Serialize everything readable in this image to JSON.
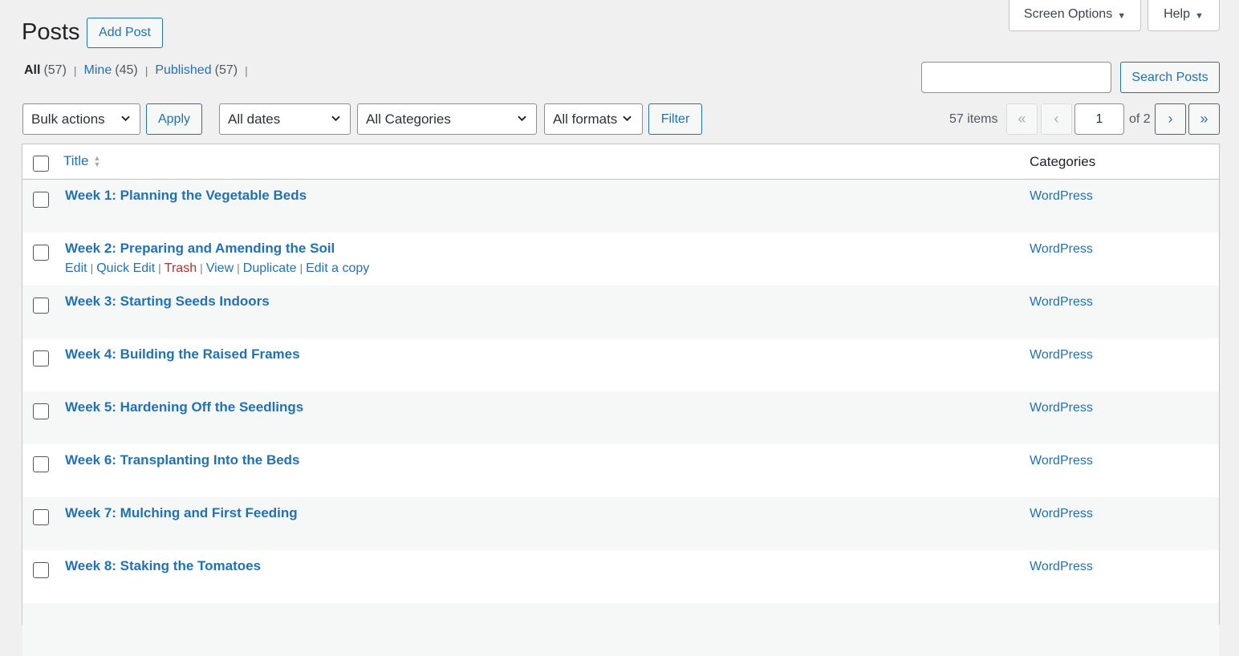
{
  "header": {
    "title": "Posts",
    "add_post": "Add Post",
    "screen_options": "Screen Options",
    "help": "Help"
  },
  "views": [
    {
      "label": "All",
      "count": "(57)"
    },
    {
      "label": "Mine",
      "count": "(45)"
    },
    {
      "label": "Published",
      "count": "(57)"
    }
  ],
  "search": {
    "button": "Search Posts",
    "value": ""
  },
  "filters": {
    "bulk_actions": "Bulk actions",
    "apply": "Apply",
    "dates": "All dates",
    "categories": "All Categories",
    "formats": "All formats",
    "filter": "Filter"
  },
  "pagination": {
    "items": "57 items",
    "first": "«",
    "prev": "‹",
    "current_page": "1",
    "of_total": "of 2",
    "next": "›",
    "last": "»"
  },
  "table": {
    "col_title": "Title",
    "col_categories": "Categories",
    "row_actions": {
      "edit": "Edit",
      "quick_edit": "Quick Edit",
      "trash": "Trash",
      "view": "View",
      "duplicate": "Duplicate",
      "edit_copy": "Edit a copy"
    },
    "rows": [
      {
        "title": "Week 1: Planning the Vegetable Beds",
        "category": "WordPress"
      },
      {
        "title": "Week 2: Preparing and Amending the Soil",
        "category": "WordPress"
      },
      {
        "title": "Week 3: Starting Seeds Indoors",
        "category": "WordPress"
      },
      {
        "title": "Week 4: Building the Raised Frames",
        "category": "WordPress"
      },
      {
        "title": "Week 5: Hardening Off the Seedlings",
        "category": "WordPress"
      },
      {
        "title": "Week 6: Transplanting Into the Beds",
        "category": "WordPress"
      },
      {
        "title": "Week 7: Mulching and First Feeding",
        "category": "WordPress"
      },
      {
        "title": "Week 8: Staking the Tomatoes",
        "category": "WordPress"
      }
    ]
  }
}
